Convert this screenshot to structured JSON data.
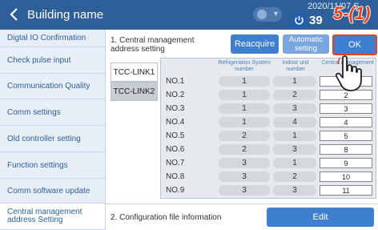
{
  "header": {
    "title": "Building name",
    "datetime": "2020/11/07 S",
    "temperature": "39",
    "annotation": "5-(1)"
  },
  "sidebar": {
    "items": [
      {
        "label": "Digtal IO Confirmation"
      },
      {
        "label": "Check pulse input"
      },
      {
        "label": "Communication Quality"
      },
      {
        "label": "Comm settings"
      },
      {
        "label": "Old controller setting"
      },
      {
        "label": "Function settings"
      },
      {
        "label": "Comm software update"
      },
      {
        "label": "Central management address Setting"
      }
    ]
  },
  "section1": {
    "label": "1. Central management address setting",
    "reacquire": "Reacquire",
    "automatic": "Automatic setting",
    "ok": "OK"
  },
  "tabs": [
    "TCC-LINK1",
    "TCC-LINK2"
  ],
  "table": {
    "headers": [
      "Refrigeration System number",
      "Indoor unit number",
      "Central management"
    ],
    "rows": [
      {
        "no": "NO.1",
        "ref": "1",
        "indoor": "1",
        "cm": ""
      },
      {
        "no": "NO.2",
        "ref": "1",
        "indoor": "2",
        "cm": "2"
      },
      {
        "no": "NO.3",
        "ref": "1",
        "indoor": "3",
        "cm": "3"
      },
      {
        "no": "NO.4",
        "ref": "1",
        "indoor": "4",
        "cm": "4"
      },
      {
        "no": "NO.5",
        "ref": "2",
        "indoor": "1",
        "cm": "5"
      },
      {
        "no": "NO.6",
        "ref": "2",
        "indoor": "3",
        "cm": "8"
      },
      {
        "no": "NO.7",
        "ref": "3",
        "indoor": "1",
        "cm": "9"
      },
      {
        "no": "NO.8",
        "ref": "3",
        "indoor": "2",
        "cm": "10"
      },
      {
        "no": "NO.9",
        "ref": "3",
        "indoor": "3",
        "cm": "11"
      }
    ]
  },
  "section2": {
    "label": "2. Configuration file information",
    "edit": "Edit"
  },
  "colors": {
    "header": "#2e5f99",
    "button": "#3f7fcf",
    "highlight": "#e8421c"
  }
}
